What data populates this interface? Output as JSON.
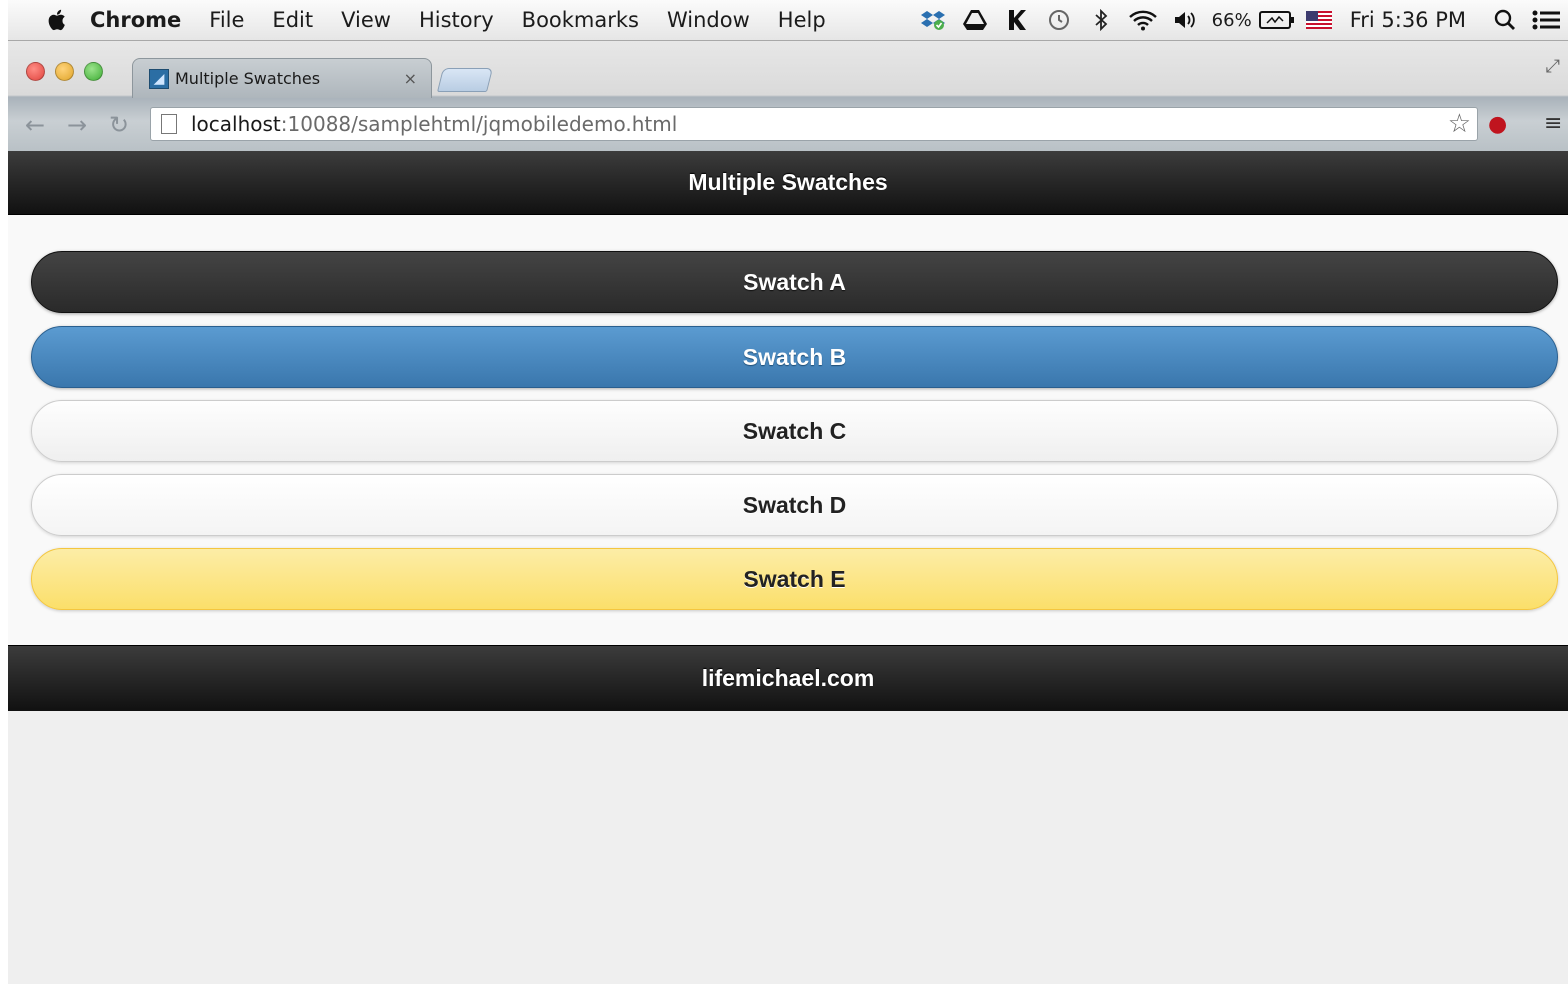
{
  "menubar": {
    "app_name": "Chrome",
    "items": [
      "File",
      "Edit",
      "View",
      "History",
      "Bookmarks",
      "Window",
      "Help"
    ],
    "battery_percent": "66%",
    "clock": "Fri 5:36 PM"
  },
  "browser": {
    "tab_title": "Multiple Swatches",
    "tab_close": "×",
    "url_host": "localhost",
    "url_path": ":10088/samplehtml/jqmobiledemo.html"
  },
  "page": {
    "header_title": "Multiple Swatches",
    "swatches": [
      {
        "label": "Swatch A",
        "color": "#333333"
      },
      {
        "label": "Swatch B",
        "color": "#4a88c2"
      },
      {
        "label": "Swatch C",
        "color": "#f6f6f6"
      },
      {
        "label": "Swatch D",
        "color": "#ffffff"
      },
      {
        "label": "Swatch E",
        "color": "#fbe26f"
      }
    ],
    "footer_text": "lifemichael.com"
  }
}
